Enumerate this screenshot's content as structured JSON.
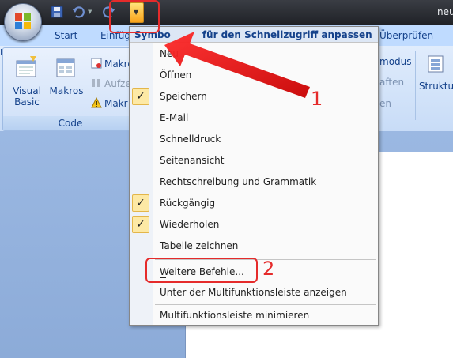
{
  "window": {
    "doc_title": "neu"
  },
  "tabs": [
    {
      "label": "Start"
    },
    {
      "label": "Einfüg"
    },
    {
      "label": "Überprüfen"
    }
  ],
  "ribbon": {
    "code_group": {
      "label": "Code",
      "visual_basic": "Visual Basic",
      "macros": "Makros",
      "small_items": [
        "Makro",
        "Aufze",
        "Makr"
      ]
    },
    "right_group": {
      "rows": [
        "modus",
        "aften",
        "en"
      ],
      "structure": "Struktu"
    }
  },
  "menu": {
    "header_prefix": "Symbo",
    "header_suffix": "für den Schnellzugriff anpassen",
    "items": [
      {
        "label": "Neu",
        "checked": false
      },
      {
        "label": "Öffnen",
        "checked": false
      },
      {
        "label": "Speichern",
        "checked": true
      },
      {
        "label": "E-Mail",
        "checked": false
      },
      {
        "label": "Schnelldruck",
        "checked": false
      },
      {
        "label": "Seitenansicht",
        "checked": false
      },
      {
        "label": "Rechtschreibung und Grammatik",
        "checked": false
      },
      {
        "label": "Rückgängig",
        "checked": true
      },
      {
        "label": "Wiederholen",
        "checked": true
      },
      {
        "label": "Tabelle zeichnen",
        "checked": false
      }
    ],
    "more_commands": "Weitere Befehle...",
    "below_ribbon": "Unter der Multifunktionsleiste anzeigen",
    "minimize": "Multifunktionsleiste minimieren"
  },
  "annotations": {
    "callout_1": "1",
    "callout_2": "2"
  },
  "colors": {
    "accent": "#e52b2b",
    "check_bg": "#fde9a5"
  },
  "checkmark": "✓"
}
